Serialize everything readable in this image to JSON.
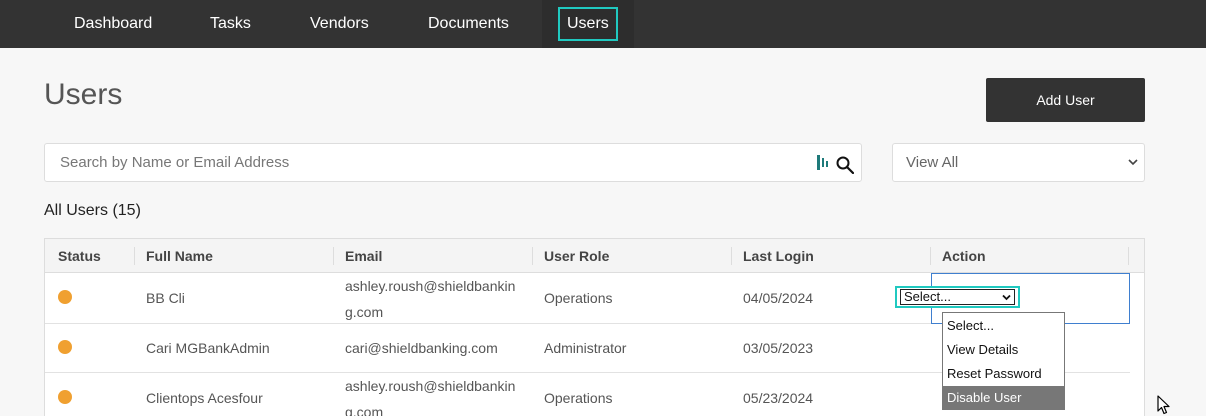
{
  "nav": {
    "items": [
      {
        "label": "Dashboard"
      },
      {
        "label": "Tasks"
      },
      {
        "label": "Vendors"
      },
      {
        "label": "Documents"
      },
      {
        "label": "Users"
      }
    ],
    "active": "Users"
  },
  "page": {
    "title": "Users",
    "add_user_label": "Add User"
  },
  "search": {
    "placeholder": "Search by Name or Email Address",
    "value": ""
  },
  "filter": {
    "selected": "View All"
  },
  "summary": {
    "all_users": "All Users (15)"
  },
  "table": {
    "headers": [
      "Status",
      "Full Name",
      "Email",
      "User Role",
      "Last Login",
      "Action"
    ],
    "rows": [
      {
        "status_color": "#f0a030",
        "name": "BB Cli",
        "email": "ashley.roush@shieldbanking.com",
        "role": "Operations",
        "last_login": "04/05/2024"
      },
      {
        "status_color": "#f0a030",
        "name": "Cari MGBankAdmin",
        "email": "cari@shieldbanking.com",
        "role": "Administrator",
        "last_login": "03/05/2023"
      },
      {
        "status_color": "#f0a030",
        "name": "Clientops Acesfour",
        "email": "ashley.roush@shieldbanking.com",
        "role": "Operations",
        "last_login": "05/23/2024"
      }
    ]
  },
  "action_select": {
    "selected": "Select...",
    "options": [
      "Select...",
      "View Details",
      "Reset Password",
      "Disable User"
    ],
    "highlighted": "Disable User"
  },
  "colors": {
    "nav_bg": "#333333",
    "focus_outline": "#20c9c0",
    "status_dot": "#f0a030",
    "primary_button": "#333333"
  }
}
